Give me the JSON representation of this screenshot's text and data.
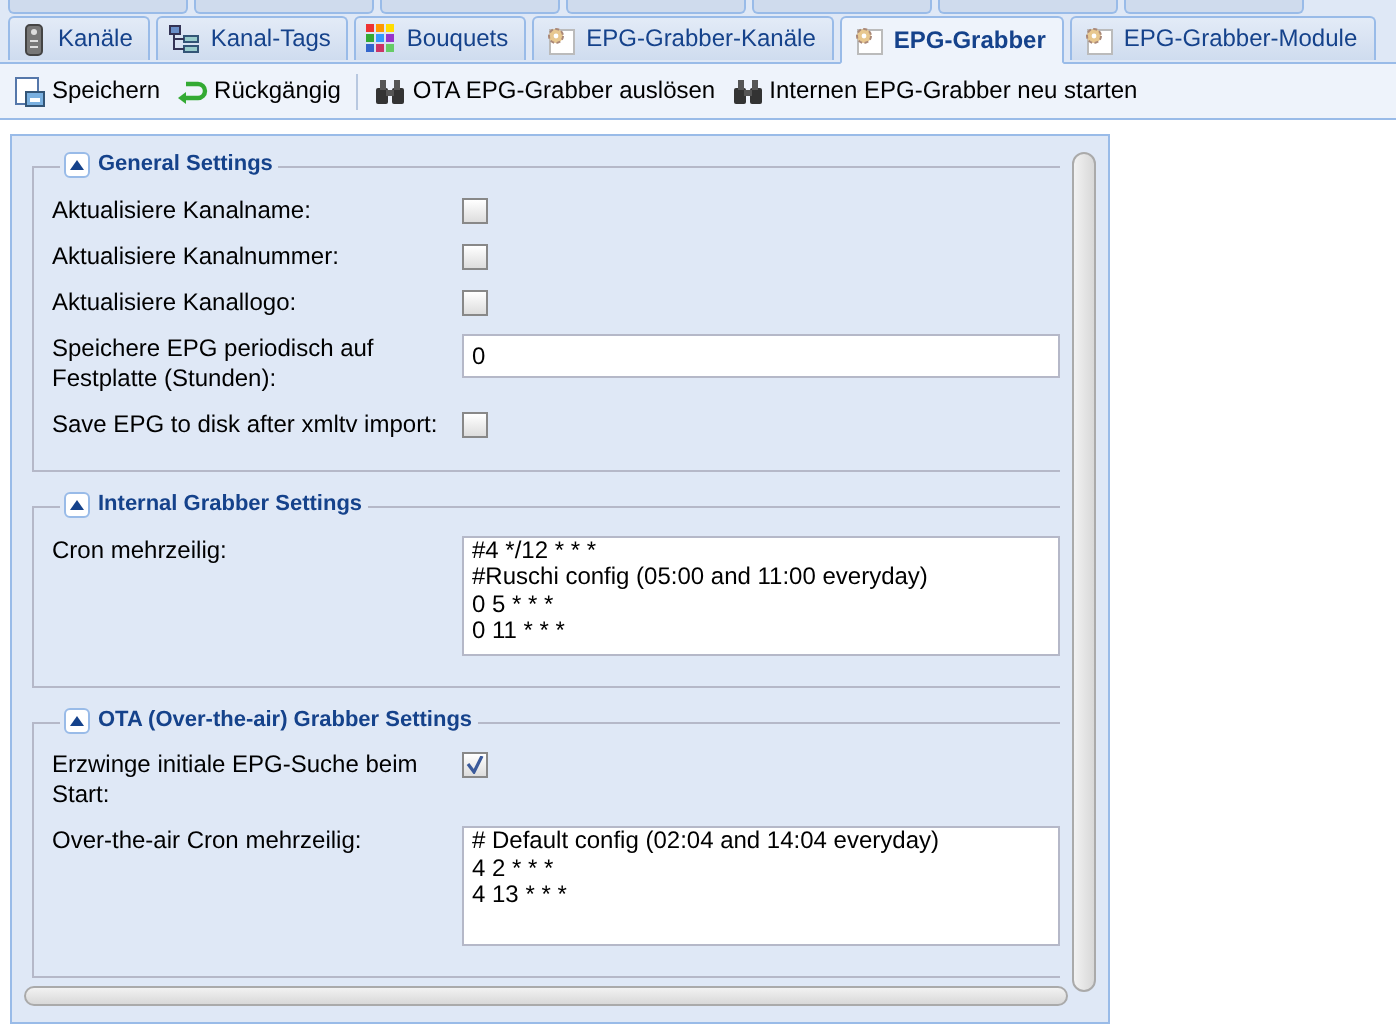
{
  "tabs": [
    {
      "label": "Kanäle",
      "selected": false
    },
    {
      "label": "Kanal-Tags",
      "selected": false
    },
    {
      "label": "Bouquets",
      "selected": false
    },
    {
      "label": "EPG-Grabber-Kanäle",
      "selected": false
    },
    {
      "label": "EPG-Grabber",
      "selected": true
    },
    {
      "label": "EPG-Grabber-Module",
      "selected": false
    }
  ],
  "toolbar": [
    {
      "label": "Speichern",
      "kind": "button"
    },
    {
      "label": "Rückgängig",
      "kind": "button"
    },
    {
      "kind": "separator"
    },
    {
      "label": "OTA EPG-Grabber auslösen",
      "kind": "button"
    },
    {
      "label": "Internen EPG-Grabber neu starten",
      "kind": "button"
    }
  ],
  "sections": [
    {
      "title": "General Settings",
      "expanded": true,
      "fields": [
        {
          "kind": "checkbox",
          "label": "Aktualisiere Kanalname:",
          "checked": false
        },
        {
          "kind": "checkbox",
          "label": "Aktualisiere Kanalnummer:",
          "checked": false
        },
        {
          "kind": "checkbox",
          "label": "Aktualisiere Kanallogo:",
          "checked": false
        },
        {
          "kind": "text",
          "label": "Speichere EPG periodisch auf Festplatte (Stunden):",
          "value": "0"
        },
        {
          "kind": "checkbox",
          "label": "Save EPG to disk after xmltv import:",
          "checked": false
        }
      ]
    },
    {
      "title": "Internal Grabber Settings",
      "expanded": true,
      "fields": [
        {
          "kind": "textarea",
          "label": "Cron mehrzeilig:",
          "lines": [
            "#4 */12 * * *",
            "#Ruschi config (05:00 and 11:00 everyday)",
            "0 5 * * *",
            "0 11 * * *"
          ]
        }
      ]
    },
    {
      "title": "OTA (Over-the-air) Grabber Settings",
      "expanded": true,
      "fields": [
        {
          "kind": "checkbox",
          "label": "Erzwinge initiale EPG-Suche beim Start:",
          "checked": true
        },
        {
          "kind": "textarea",
          "label": "Over-the-air Cron mehrzeilig:",
          "lines": [
            "# Default config (02:04 and 14:04 everyday)",
            "4 2 * * *",
            "4 13 * * *"
          ]
        }
      ]
    }
  ]
}
